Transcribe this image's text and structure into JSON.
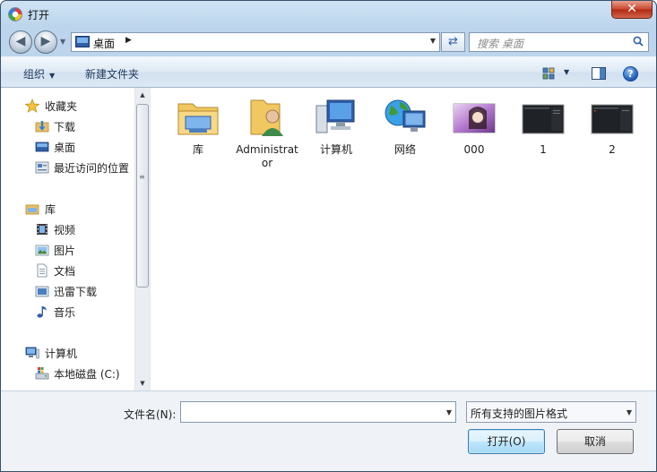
{
  "window": {
    "title": "打开",
    "close_label": "✕"
  },
  "nav": {
    "back_label": "◀",
    "forward_label": "▶",
    "address_path": "桌面",
    "refresh_label": "⇄",
    "search_placeholder": "搜索 桌面"
  },
  "toolbar": {
    "organize_label": "组织",
    "new_folder_label": "新建文件夹",
    "help_label": "?"
  },
  "sidebar": {
    "items": [
      {
        "label": "收藏夹",
        "icon": "star-icon",
        "level": 0
      },
      {
        "label": "下载",
        "icon": "download-folder-icon",
        "level": 1
      },
      {
        "label": "桌面",
        "icon": "desktop-icon",
        "level": 1
      },
      {
        "label": "最近访问的位置",
        "icon": "recent-places-icon",
        "level": 1
      },
      {
        "label": "库",
        "icon": "library-icon",
        "level": 0
      },
      {
        "label": "视频",
        "icon": "video-icon",
        "level": 1
      },
      {
        "label": "图片",
        "icon": "picture-icon",
        "level": 1
      },
      {
        "label": "文档",
        "icon": "document-icon",
        "level": 1
      },
      {
        "label": "迅雷下载",
        "icon": "thunder-download-icon",
        "level": 1
      },
      {
        "label": "音乐",
        "icon": "music-icon",
        "level": 1
      },
      {
        "label": "计算机",
        "icon": "computer-icon",
        "level": 0
      },
      {
        "label": "本地磁盘 (C:)",
        "icon": "drive-icon",
        "level": 1
      }
    ]
  },
  "files": [
    {
      "name": "库",
      "icon": "library-folder-icon"
    },
    {
      "name": "Administrator",
      "icon": "user-folder-icon"
    },
    {
      "name": "计算机",
      "icon": "computer-icon"
    },
    {
      "name": "网络",
      "icon": "network-icon"
    },
    {
      "name": "000",
      "icon": "image-thumbnail"
    },
    {
      "name": "1",
      "icon": "dark-screenshot-thumbnail"
    },
    {
      "name": "2",
      "icon": "dark-screenshot-thumbnail"
    }
  ],
  "footer": {
    "filename_label": "文件名(N):",
    "filename_value": "",
    "filter_value": "所有支持的图片格式",
    "open_label": "打开(O)",
    "cancel_label": "取消"
  },
  "colors": {
    "accent": "#2f5fa8",
    "window_frame": "#bcd5ec",
    "close": "#c8452c"
  }
}
